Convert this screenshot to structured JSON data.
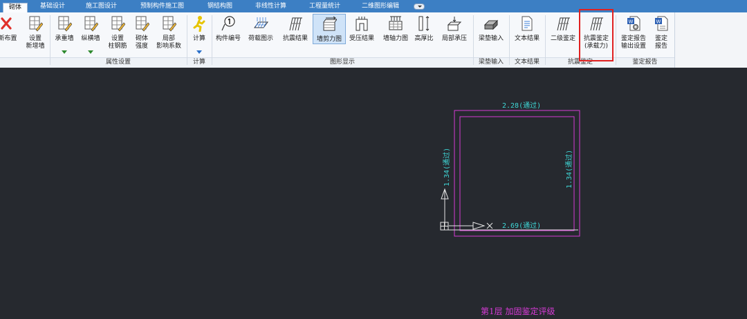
{
  "tabs": [
    {
      "label": "砌体",
      "active": true
    },
    {
      "label": "基础设计"
    },
    {
      "label": "施工图设计"
    },
    {
      "label": "预制构件施工图"
    },
    {
      "label": "钢结构图"
    },
    {
      "label": "非线性计算"
    },
    {
      "label": "工程量统计"
    },
    {
      "label": "二维图形编辑"
    }
  ],
  "ribbon": {
    "buttons": {
      "new_layout": "新布置",
      "set_new_wall_1": "设置",
      "set_new_wall_2": "新增墙",
      "bearing_wall": "承重墙",
      "longitudinal_wall": "纵横墙",
      "set_column_rebar_1": "设置",
      "set_column_rebar_2": "柱钢筋",
      "masonry_strength_1": "砌体",
      "masonry_strength_2": "强度",
      "local_influence_1": "局部",
      "local_influence_2": "影响系数",
      "calculate": "计算",
      "member_number": "构件编号",
      "load_diagram": "荷载图示",
      "seismic_result": "抗震结果",
      "wall_shear_diagram": "墙剪力图",
      "compression_result": "受压结果",
      "wall_axial_diagram": "墙轴力图",
      "height_thickness_ratio": "高厚比",
      "local_compression": "局部承压",
      "beam_pad_input": "梁垫输入",
      "text_result": "文本结果",
      "level2_check": "二级鉴定",
      "seismic_check_capacity_1": "抗震鉴定",
      "seismic_check_capacity_2": "(承载力)",
      "report_output_settings_1": "鉴定报告",
      "report_output_settings_2": "输出设置",
      "report_1": "鉴定",
      "report_2": "报告"
    },
    "groups": {
      "property_settings": "属性设置",
      "calculation": "计算",
      "graphic_display": "图形显示",
      "beam_pad_input": "梁垫输入",
      "text_result": "文本结果",
      "seismic_check": "抗震鉴定",
      "check_report": "鉴定报告"
    }
  },
  "canvas": {
    "top_label": "2.28(通过)",
    "bottom_label": "2.69(通过)",
    "left_label": "1.34(通过)",
    "right_label": "1.34(通过)",
    "footer": "第1层  加固鉴定评级"
  },
  "colors": {
    "canvas_bg": "#26292f",
    "wall_line": "#d63bd6",
    "result_text": "#3fd6d6",
    "highlight": "#e0201f",
    "tab_bar": "#3c7fc4"
  }
}
